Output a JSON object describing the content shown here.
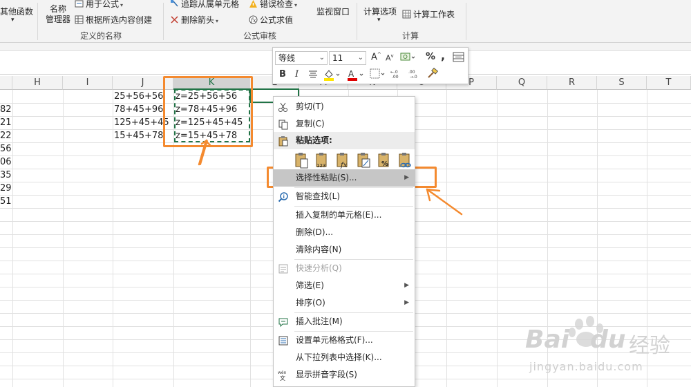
{
  "ribbon": {
    "other_functions": "其他函数",
    "name_manager_line1": "名称",
    "name_manager_line2": "管理器",
    "use_in_formula": "用于公式",
    "create_from_selection": "根据所选内容创建",
    "group_defined_names": "定义的名称",
    "trace_precedents": "追踪从属单元格",
    "remove_arrows": "删除箭头",
    "error_checking": "错误检查",
    "evaluate_formula": "公式求值",
    "group_formula_auditing": "公式审核",
    "watch_window": "监视窗口",
    "calc_options": "计算选项",
    "calc_sheet": "计算工作表",
    "group_calculation": "计算"
  },
  "mini_toolbar": {
    "font_name": "等线",
    "font_size": "11",
    "bold": "B",
    "italic": "I",
    "percent": "%",
    "comma": ","
  },
  "columns": [
    "H",
    "I",
    "J",
    "K",
    "L",
    "M",
    "N",
    "O",
    "P",
    "Q",
    "R",
    "S",
    "T"
  ],
  "row_partial_values": [
    "82",
    "21",
    "22",
    "56",
    "06",
    "35",
    "29",
    "51"
  ],
  "cells": {
    "J": [
      "25+56+56",
      "78+45+96",
      "125+45+45",
      "15+45+78"
    ],
    "K": [
      "z=25+56+56",
      "z=78+45+96",
      "z=125+45+45",
      "z=15+45+78"
    ]
  },
  "context_menu": {
    "cut": "剪切(T)",
    "copy": "复制(C)",
    "paste_options": "粘贴选项:",
    "paste_special": "选择性粘贴(S)...",
    "smart_lookup": "智能查找(L)",
    "insert_copied": "插入复制的单元格(E)...",
    "delete": "删除(D)...",
    "clear_contents": "清除内容(N)",
    "quick_analysis": "快速分析(Q)",
    "filter": "筛选(E)",
    "sort": "排序(O)",
    "insert_comment": "插入批注(M)",
    "format_cells": "设置单元格格式(F)...",
    "pick_from_list": "从下拉列表中选择(K)...",
    "show_phonetic": "显示拼音字段(S)"
  },
  "watermark": {
    "brand": "Bai",
    "brand2": "du",
    "cn": "经验",
    "url": "jingyan.baidu.com"
  },
  "colors": {
    "accent_green": "#217346",
    "highlight_orange": "#f48a2f",
    "menu_highlight": "#c6c6c6"
  }
}
